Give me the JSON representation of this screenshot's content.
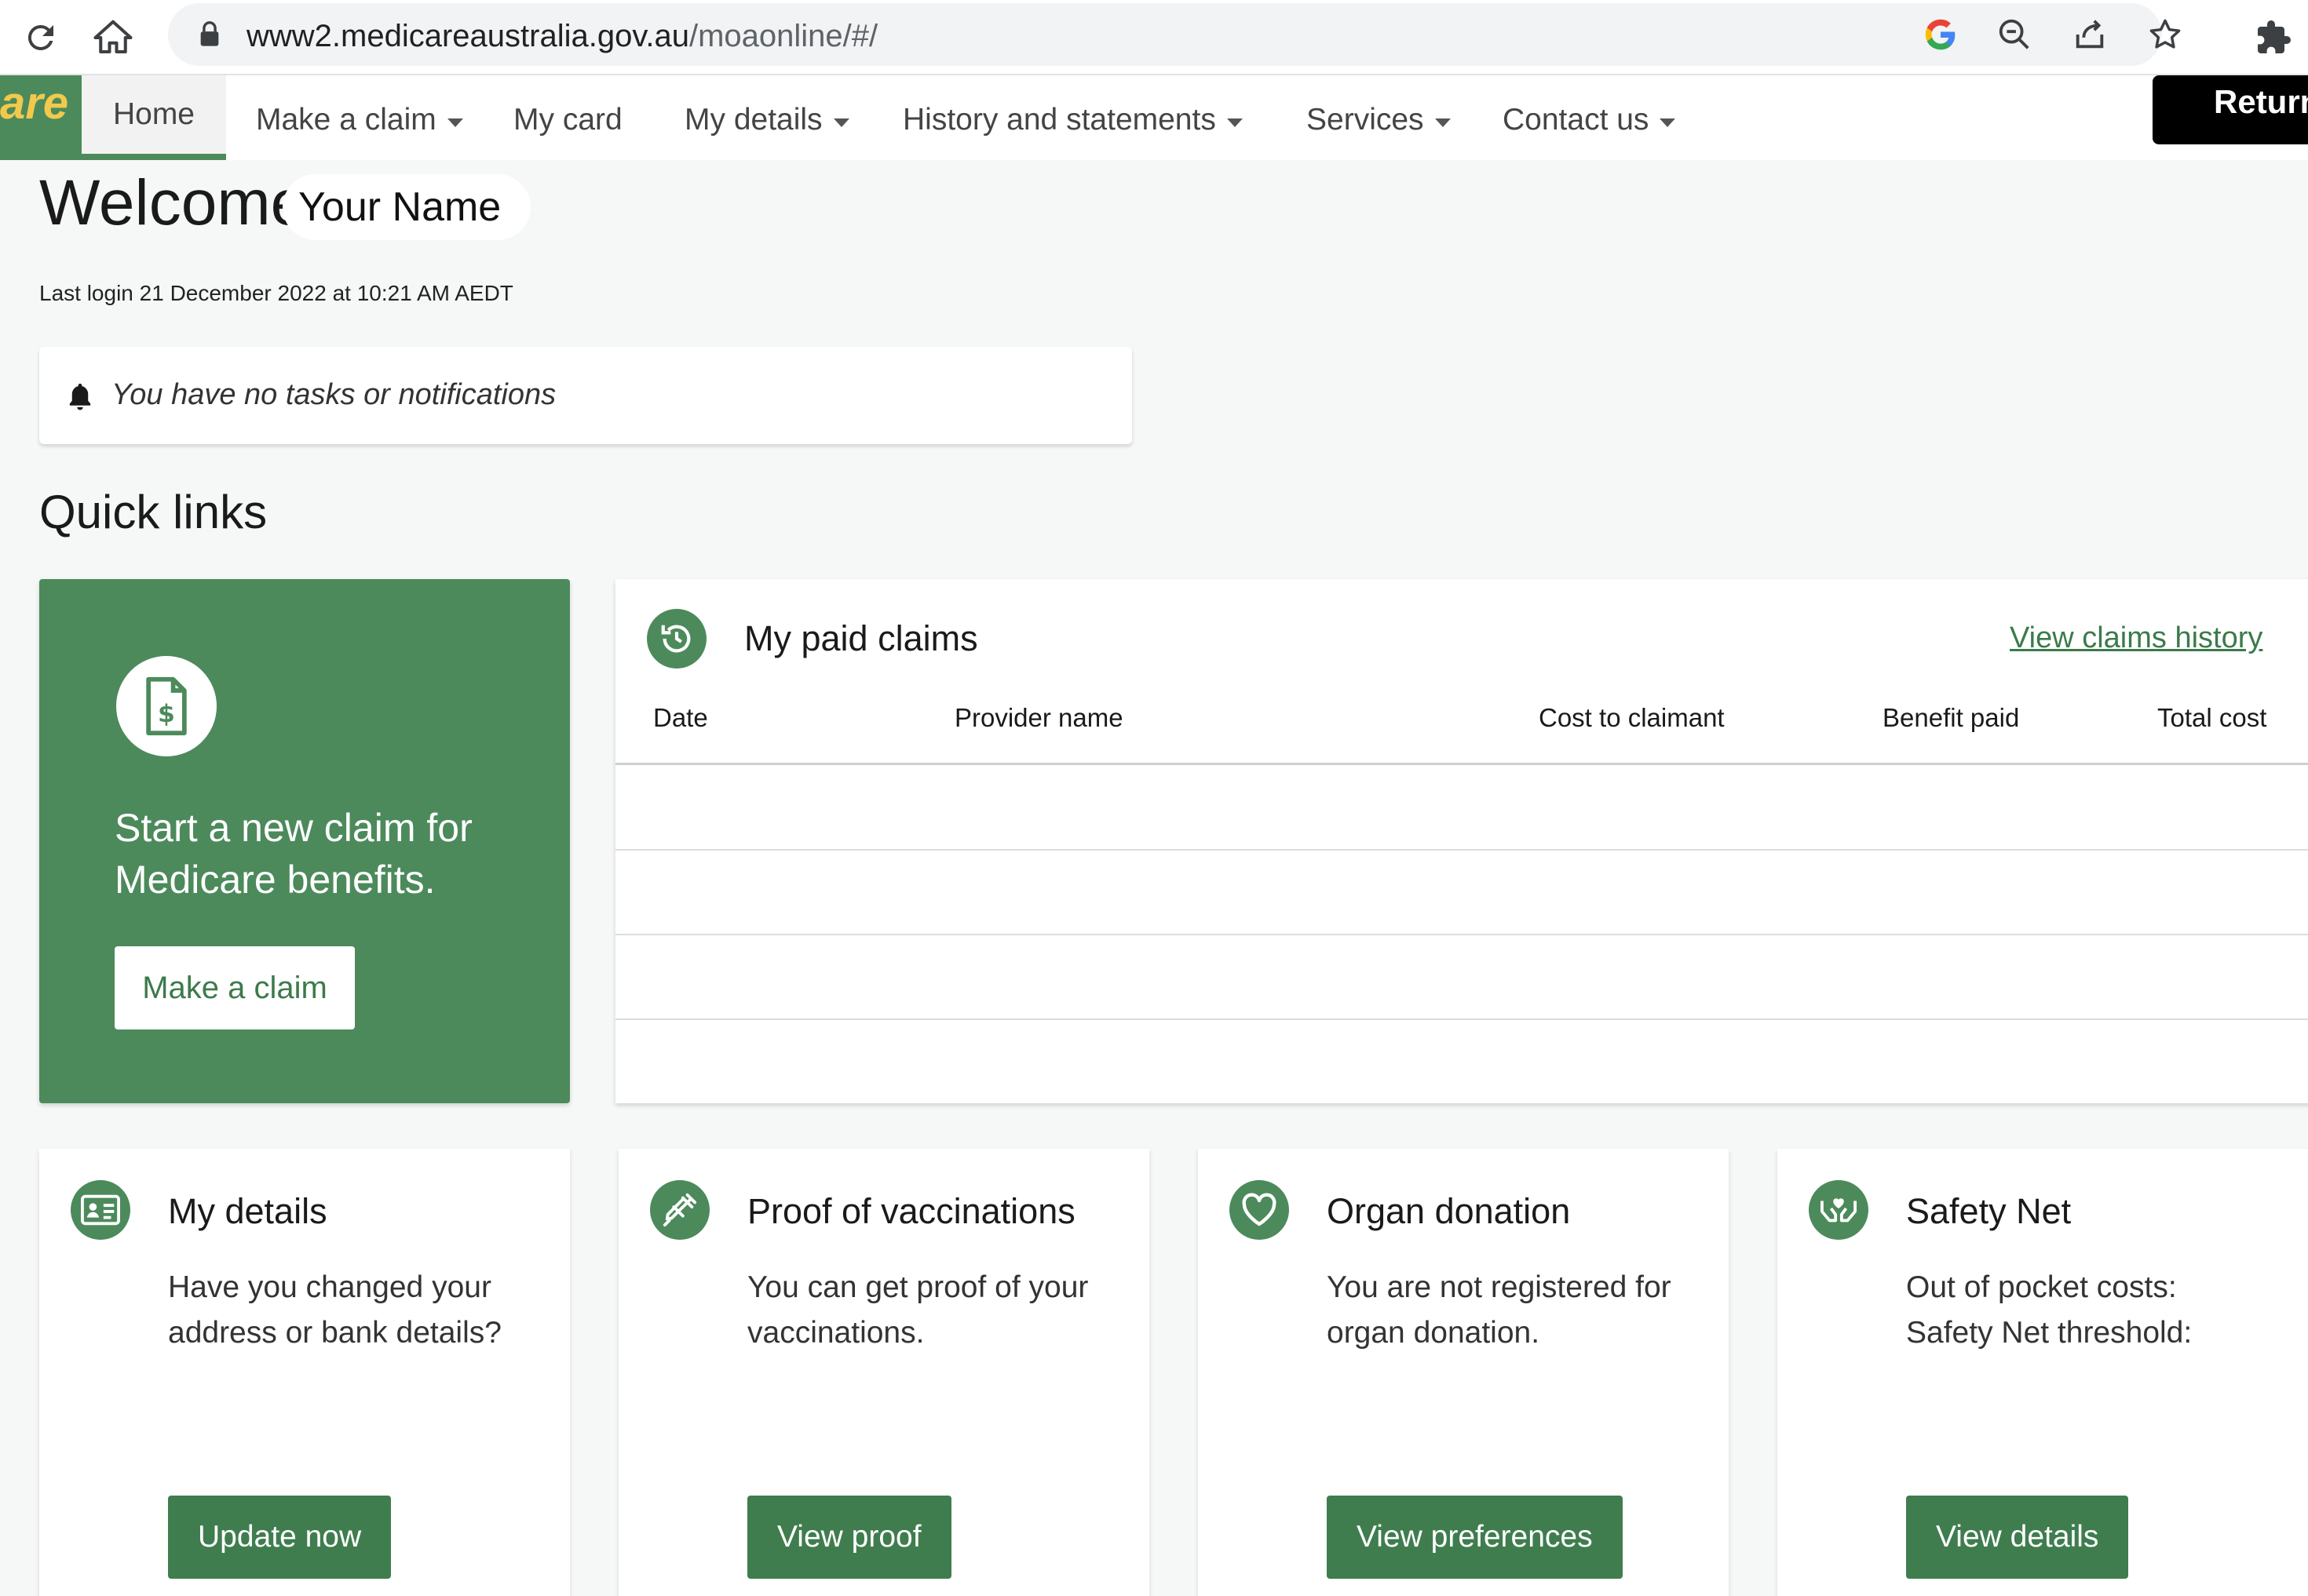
{
  "browser": {
    "url_host": "www2.medicareaustralia.gov.au",
    "url_path": "/moaonline/#/"
  },
  "nav": {
    "logo_text": "are",
    "home": "Home",
    "make_claim": "Make a claim",
    "my_card": "My card",
    "my_details": "My details",
    "history": "History and statements",
    "services": "Services",
    "contact": "Contact us",
    "return": "Return"
  },
  "welcome": {
    "greeting": "Welcome",
    "name": "Your Name",
    "last_login": "Last login 21 December 2022 at 10:21 AM AEDT"
  },
  "notifications": {
    "text": "You have no tasks or notifications"
  },
  "quick_links": {
    "heading": "Quick links",
    "claim_card": {
      "text": "Start a new claim for Medicare benefits.",
      "button": "Make a claim"
    }
  },
  "paid_claims": {
    "title": "My paid claims",
    "link": "View claims history",
    "columns": [
      "Date",
      "Provider name",
      "Cost to claimant",
      "Benefit paid",
      "Total cost"
    ]
  },
  "cards": [
    {
      "title": "My details",
      "lines": [
        "Have you changed your",
        "address or bank details?"
      ],
      "button": "Update now"
    },
    {
      "title": "Proof of vaccinations",
      "lines": [
        "You can get proof of your",
        "vaccinations."
      ],
      "button": "View proof"
    },
    {
      "title": "Organ donation",
      "lines": [
        "You are not registered for",
        "organ donation."
      ],
      "button": "View preferences"
    },
    {
      "title": "Safety Net",
      "lines": [
        "Out of pocket costs:",
        "Safety Net threshold:"
      ],
      "button": "View details"
    }
  ],
  "colors": {
    "brand_green": "#4c8a5b",
    "button_green": "#3f7d4e",
    "logo_yellow": "#f2c94c"
  }
}
